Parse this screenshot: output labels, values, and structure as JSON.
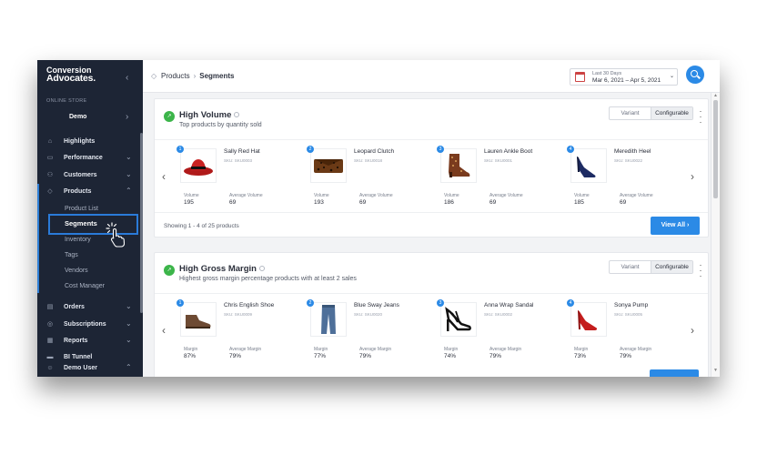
{
  "sidebar": {
    "brand_line1": "Conversion",
    "brand_line2": "Advocates.",
    "collapse_glyph": "‹",
    "store_label": "ONLINE STORE",
    "store_name": "Demo",
    "nav": [
      {
        "label": "Highlights",
        "icon": "home-icon"
      },
      {
        "label": "Performance",
        "icon": "performance-icon"
      },
      {
        "label": "Customers",
        "icon": "customers-icon"
      },
      {
        "label": "Products",
        "icon": "tag-icon"
      }
    ],
    "sub_items": [
      "Product List",
      "Segments",
      "Inventory",
      "Tags",
      "Vendors",
      "Cost Manager"
    ],
    "nav_bottom": [
      {
        "label": "Orders",
        "icon": "orders-icon"
      },
      {
        "label": "Subscriptions",
        "icon": "subscriptions-icon"
      },
      {
        "label": "Reports",
        "icon": "reports-icon"
      },
      {
        "label": "BI Tunnel",
        "icon": "tunnel-icon"
      },
      {
        "label": "Demo User",
        "icon": "user-icon"
      }
    ]
  },
  "header": {
    "crumb1": "Products",
    "crumb_sep": "›",
    "crumb2": "Segments",
    "date_range_label": "Last 30 Days",
    "date_range_value": "Mar 6, 2021 – Apr 5, 2021"
  },
  "toggle": {
    "variant": "Variant",
    "configurable": "Configurable"
  },
  "cards": [
    {
      "title": "High Volume",
      "subtitle": "Top products by quantity sold",
      "metric1_label": "Volume",
      "metric2_label": "Average Volume",
      "products": [
        {
          "rank": "1",
          "name": "Sally Red Hat",
          "sku": "SKU: SKU0003",
          "m1": "195",
          "m2": "69"
        },
        {
          "rank": "2",
          "name": "Leopard Clutch",
          "sku": "SKU: SKU0018",
          "m1": "193",
          "m2": "69"
        },
        {
          "rank": "3",
          "name": "Lauren Ankle Boot",
          "sku": "SKU: SKU0001",
          "m1": "186",
          "m2": "69"
        },
        {
          "rank": "4",
          "name": "Meredith Heel",
          "sku": "SKU: SKU0022",
          "m1": "185",
          "m2": "69"
        }
      ],
      "showing": "Showing 1 - 4 of 25 products",
      "view_all": "View All ›"
    },
    {
      "title": "High Gross Margin",
      "subtitle": "Highest gross margin percentage products with at least 2 sales",
      "metric1_label": "Margin",
      "metric2_label": "Average Margin",
      "products": [
        {
          "rank": "1",
          "name": "Chris English Shoe",
          "sku": "SKU: SKU0009",
          "m1": "87%",
          "m2": "79%"
        },
        {
          "rank": "2",
          "name": "Blue Sway Jeans",
          "sku": "SKU: SKU0020",
          "m1": "77%",
          "m2": "79%"
        },
        {
          "rank": "3",
          "name": "Anna Wrap Sandal",
          "sku": "SKU: SKU0002",
          "m1": "74%",
          "m2": "79%"
        },
        {
          "rank": "4",
          "name": "Sonya Pump",
          "sku": "SKU: SKU0005",
          "m1": "73%",
          "m2": "79%"
        }
      ]
    }
  ],
  "colors": {
    "accent": "#2b8ae6",
    "sidebar_bg": "#1d2535",
    "trend_green": "#3cb54a",
    "selection": "#2a7bd9"
  }
}
